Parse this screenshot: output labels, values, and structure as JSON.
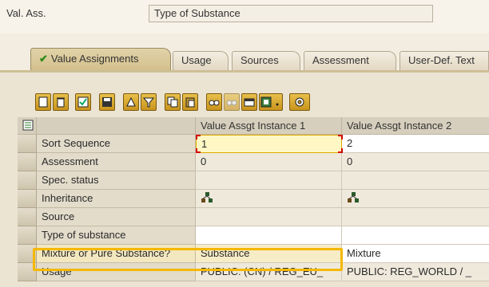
{
  "header": {
    "label": "Val. Ass.",
    "value": "Type of Substance"
  },
  "tabs": [
    {
      "label": "Value Assignments",
      "active": true
    },
    {
      "label": "Usage"
    },
    {
      "label": "Sources"
    },
    {
      "label": "Assessment"
    },
    {
      "label": "User-Def. Text"
    }
  ],
  "toolbar_icons": [
    "create-icon",
    "delete-icon",
    "check-icon",
    "save-icon",
    "print-icon",
    "filter-icon",
    "copy-icon",
    "paste-icon",
    "find-icon",
    "find-next-icon",
    "layout-icon",
    "export-icon",
    "dropdown-icon",
    "settings-icon"
  ],
  "grid": {
    "columns": [
      "Value Assgt Instance 1",
      "Value Assgt Instance 2"
    ],
    "rows": [
      {
        "label": "Sort Sequence",
        "v1": "1",
        "v2": "2"
      },
      {
        "label": "Assessment",
        "v1": "0",
        "v2": "0"
      },
      {
        "label": "Spec. status",
        "v1": "",
        "v2": ""
      },
      {
        "label": "Inheritance",
        "v1": "",
        "v2": ""
      },
      {
        "label": "Source",
        "v1": "",
        "v2": ""
      },
      {
        "label": "Type of substance",
        "v1": "",
        "v2": ""
      },
      {
        "label": "Mixture or Pure Substance?",
        "v1": "Substance",
        "v2": "Mixture"
      },
      {
        "label": "Usage",
        "v1": "PUBLIC: (CN) / REG_EU_",
        "v2": "PUBLIC: REG_WORLD / _"
      }
    ]
  },
  "colors": {
    "highlight": "#f5b800",
    "tab_active": "#d3c08c",
    "toolbar_button": "#e0b43a"
  }
}
